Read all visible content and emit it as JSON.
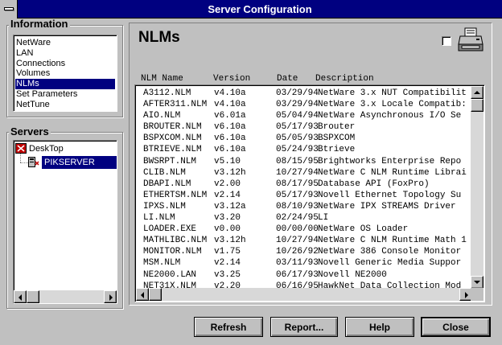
{
  "window": {
    "title": "Server Configuration"
  },
  "information": {
    "label": "Information",
    "items": [
      "NetWare",
      "LAN",
      "Connections",
      "Volumes",
      "NLMs",
      "Set Parameters",
      "NetTune"
    ],
    "selected": "NLMs"
  },
  "servers": {
    "label": "Servers",
    "root": "DeskTop",
    "child": "PIKSERVER"
  },
  "panel": {
    "title": "NLMs",
    "columns": {
      "name": "NLM Name",
      "version": "Version",
      "date": "Date",
      "description": "Description"
    },
    "rows": [
      {
        "name": "A3112.NLM",
        "version": "v4.10a",
        "date": "03/29/94",
        "description": "NetWare 3.x NUT Compatibilit"
      },
      {
        "name": "AFTER311.NLM",
        "version": "v4.10a",
        "date": "03/29/94",
        "description": "NetWare 3.x Locale Compatib:"
      },
      {
        "name": "AIO.NLM",
        "version": "v6.01a",
        "date": "05/04/94",
        "description": "NetWare Asynchronous I/O Se"
      },
      {
        "name": "BROUTER.NLM",
        "version": "v6.10a",
        "date": "05/17/93",
        "description": "Brouter"
      },
      {
        "name": "BSPXCOM.NLM",
        "version": "v6.10a",
        "date": "05/05/93",
        "description": "BSPXCOM"
      },
      {
        "name": "BTRIEVE.NLM",
        "version": "v6.10a",
        "date": "05/24/93",
        "description": "Btrieve"
      },
      {
        "name": "BWSRPT.NLM",
        "version": "v5.10",
        "date": "08/15/95",
        "description": "Brightworks Enterprise Repo"
      },
      {
        "name": "CLIB.NLM",
        "version": "v3.12h",
        "date": "10/27/94",
        "description": "NetWare C NLM Runtime Librai"
      },
      {
        "name": "DBAPI.NLM",
        "version": "v2.00",
        "date": "08/17/95",
        "description": "Database API (FoxPro)"
      },
      {
        "name": "ETHERTSM.NLM",
        "version": "v2.14",
        "date": "05/17/93",
        "description": "Novell Ethernet Topology Su"
      },
      {
        "name": "IPXS.NLM",
        "version": "v3.12a",
        "date": "08/10/93",
        "description": "NetWare IPX STREAMS Driver"
      },
      {
        "name": "LI.NLM",
        "version": "v3.20",
        "date": "02/24/95",
        "description": "LI"
      },
      {
        "name": "LOADER.EXE",
        "version": "v0.00",
        "date": "00/00/00",
        "description": "NetWare OS Loader"
      },
      {
        "name": "MATHLIBC.NLM",
        "version": "v3.12h",
        "date": "10/27/94",
        "description": "NetWare C NLM Runtime Math 1"
      },
      {
        "name": "MONITOR.NLM",
        "version": "v1.75",
        "date": "10/26/92",
        "description": "NetWare 386 Console Monitor"
      },
      {
        "name": "MSM.NLM",
        "version": "v2.14",
        "date": "03/11/93",
        "description": "Novell Generic Media Suppor"
      },
      {
        "name": "NE2000.LAN",
        "version": "v3.25",
        "date": "06/17/93",
        "description": "Novell NE2000"
      },
      {
        "name": "NET31X.NLM",
        "version": "v2.20",
        "date": "06/16/95",
        "description": "HawkNet Data Collection Mod"
      }
    ]
  },
  "buttons": {
    "refresh": "Refresh",
    "report": "Report...",
    "help": "Help",
    "close": "Close"
  }
}
